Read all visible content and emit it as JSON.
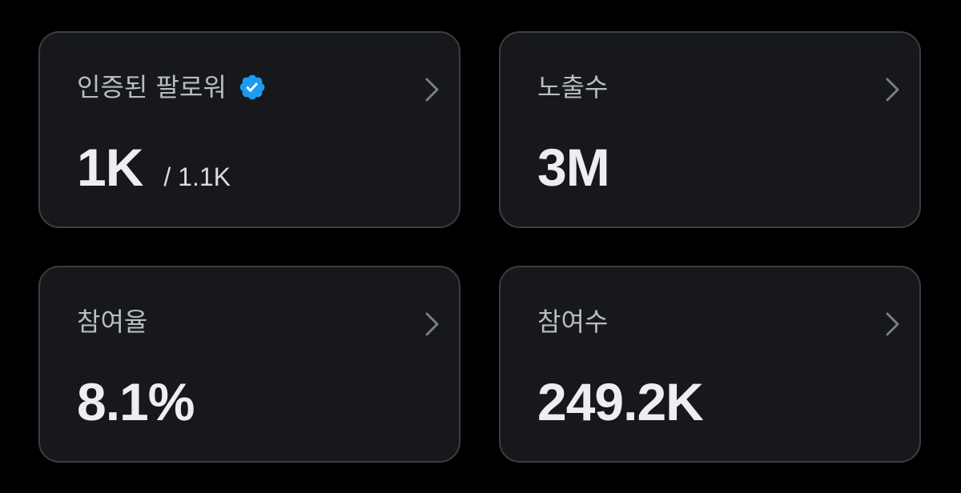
{
  "cards": [
    {
      "label": "인증된 팔로워",
      "value": "1K",
      "subvalue": "/ 1.1K",
      "has_verified_badge": true,
      "icon": "chevron-right-icon"
    },
    {
      "label": "노출수",
      "value": "3M",
      "icon": "chevron-right-icon"
    },
    {
      "label": "참여율",
      "value": "8.1%",
      "icon": "chevron-right-icon"
    },
    {
      "label": "참여수",
      "value": "249.2K",
      "icon": "chevron-right-icon"
    }
  ],
  "colors": {
    "background": "#000000",
    "card_background": "#16181c",
    "card_border": "#3a3d42",
    "label_text": "#b9bcc0",
    "value_text": "#eceeef",
    "verified_badge": "#1d9bf0"
  }
}
